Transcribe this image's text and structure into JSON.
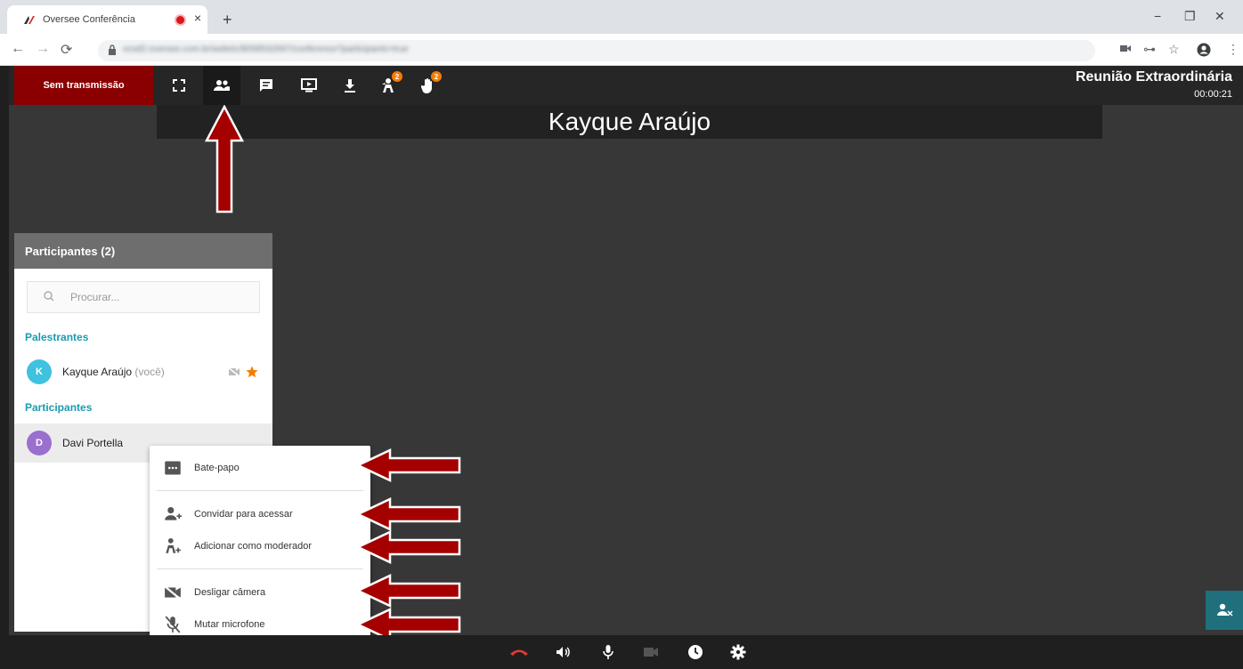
{
  "browser": {
    "tab_title": "Oversee Conferência",
    "tab_close": "×",
    "new_tab": "+",
    "minimize": "−",
    "restore": "❐",
    "close": "✕",
    "url": "vcsd2.oversee.com.br/webrtc/8058532697/conference?participants=true"
  },
  "toolbar": {
    "stream_label": "Sem transmissão",
    "icons": [
      "fullscreen-icon",
      "participants-icon",
      "chat-icon",
      "screen-share-icon",
      "download-icon",
      "moderators-icon",
      "raise-hand-icon"
    ],
    "moderator_badge": "2",
    "hand_badge": "2",
    "meeting_title": "Reunião Extraordinária",
    "meeting_timer": "00:00:21"
  },
  "stage": {
    "speaker_name": "Kayque Araújo"
  },
  "participants_panel": {
    "title": "Participantes (2)",
    "search_placeholder": "Procurar...",
    "speakers_label": "Palestrantes",
    "participants_label": "Participantes",
    "speaker": {
      "initial": "K",
      "name": "Kayque Araújo",
      "suffix": "(você)",
      "avatar_color": "#3fc1e0"
    },
    "participant": {
      "initial": "D",
      "name": "Davi Portella",
      "avatar_color": "#9a6fcf"
    }
  },
  "context_menu": {
    "chat": "Bate-papo",
    "invite": "Convidar para acessar",
    "moderator": "Adicionar como moderador",
    "camera_off": "Desligar câmera",
    "mute_mic": "Mutar microfone"
  },
  "colors": {
    "accent": "#1a9bb1",
    "stream_bg": "#8a0000",
    "arrow": "#a40000",
    "badge": "#f57c00",
    "star": "#f57c00",
    "hangup": "#e53935"
  }
}
